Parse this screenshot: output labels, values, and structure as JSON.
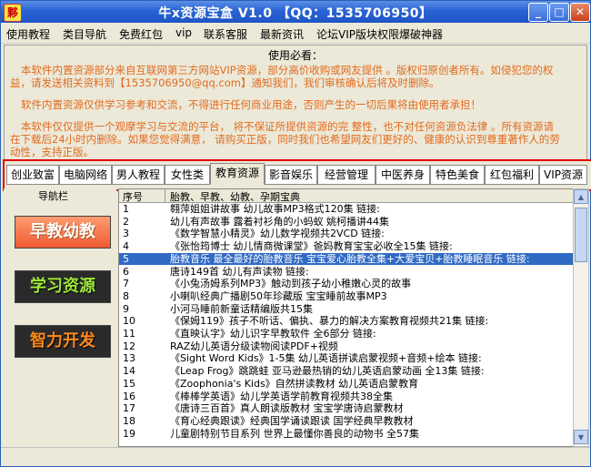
{
  "window": {
    "title": "牛x资源宝盒 V1.0 【QQ：1535706950】",
    "icon_text": "夥",
    "minimize": "_",
    "maximize": "□",
    "close": "✕"
  },
  "menu": [
    "使用教程",
    "类目导航",
    "免费红包",
    "vip",
    "联系客服",
    "最新资讯",
    "论坛VIP版块权限爆破神器"
  ],
  "notice": {
    "title": "使用必看：",
    "lines": [
      "本软件内置资源部分来自互联网第三方网站VIP资源，部分高价收购或网友提供 。版权归原创者所有。如侵犯您的权",
      "益，请发送相关资料到【1535706950@qq.com】通知我们，我们审核确认后将及时删除。",
      "软件内置资源仅供学习参考和交流，不得进行任何商业用途，否则产生的一切后果将由使用者承担！",
      "本软件仅仅提供一个观摩学习与交流的平台，  将不保证所提供资源的完 整性，也不对任何资源负法律 。所有资源请",
      "在下载后24小时内删除。如果您觉得满意，  请购买正版，同时我们也希望网友们更好的、健康的认识到尊重著作人的劳",
      "动性，支持正版。"
    ]
  },
  "tabs": [
    "创业致富",
    "电脑网络",
    "男人教程",
    "女性类",
    "教育资源",
    "影音娱乐",
    "经营管理",
    "中医养身",
    "特色美食",
    "红包福利",
    "VIP资源"
  ],
  "active_tab": "教育资源",
  "left_panel": {
    "label": "导航栏",
    "buttons": [
      "早教幼教",
      "学习资源",
      "智力开发"
    ]
  },
  "list": {
    "columns": [
      "序号",
      "胎教、早教、幼教、孕期宝典"
    ],
    "rows": [
      {
        "num": "1",
        "title": "翱萍姐姐讲故事 幼儿故事MP3格式120集 链接:"
      },
      {
        "num": "2",
        "title": "幼儿有声故事 露着衬衫角的小蚂蚁 姚柯播讲44集"
      },
      {
        "num": "3",
        "title": "《数学智慧小精灵》幼儿数学视频共2VCD 链接:"
      },
      {
        "num": "4",
        "title": "《张怡筠博士 幼儿情商微课堂》爸妈教育宝宝必收全15集 链接:"
      },
      {
        "num": "5",
        "title": "胎教音乐 最全最好的胎教音乐 宝宝爱心胎教全集+大爱宝贝+胎教睡眠音乐 链接:"
      },
      {
        "num": "6",
        "title": "唐诗149首 幼儿有声读物 链接:"
      },
      {
        "num": "7",
        "title": "《小兔汤姆系列MP3》触动到孩子幼小稚嫩心灵的故事"
      },
      {
        "num": "8",
        "title": "小喇叭经典广播剧50年珍藏版 宝宝睡前故事MP3"
      },
      {
        "num": "9",
        "title": "小河马睡前新童话精编版共15集"
      },
      {
        "num": "10",
        "title": "《保姆119》孩子不听话、偏执、暴力的解决方案教育视频共21集 链接:"
      },
      {
        "num": "11",
        "title": "《直映认字》幼儿识字早教软件 全6部分 链接:"
      },
      {
        "num": "12",
        "title": "RAZ幼儿英语分级读物阅读PDF+视频"
      },
      {
        "num": "13",
        "title": "《Sight Word Kids》1-5集 幼儿英语拼读启蒙视频+音频+绘本 链接:"
      },
      {
        "num": "14",
        "title": "《Leap Frog》跳跳蛙 亚马逊最热销的幼儿英语启蒙动画 全13集 链接:"
      },
      {
        "num": "15",
        "title": "《Zoophonia's Kids》自然拼读教材 幼儿英语启蒙教育"
      },
      {
        "num": "16",
        "title": "《棒棒学英语》幼儿学英语学前教育视频共38全集"
      },
      {
        "num": "17",
        "title": "《唐诗三百首》真人朗读版教材 宝宝学唐诗启蒙教材"
      },
      {
        "num": "18",
        "title": "《育心经典跟读》经典国学诵读跟读 国学经典早教教材"
      },
      {
        "num": "19",
        "title": "儿童剧特别节目系列 世界上最懂你善良的动物书 全57集"
      }
    ],
    "selected_index": 4
  }
}
